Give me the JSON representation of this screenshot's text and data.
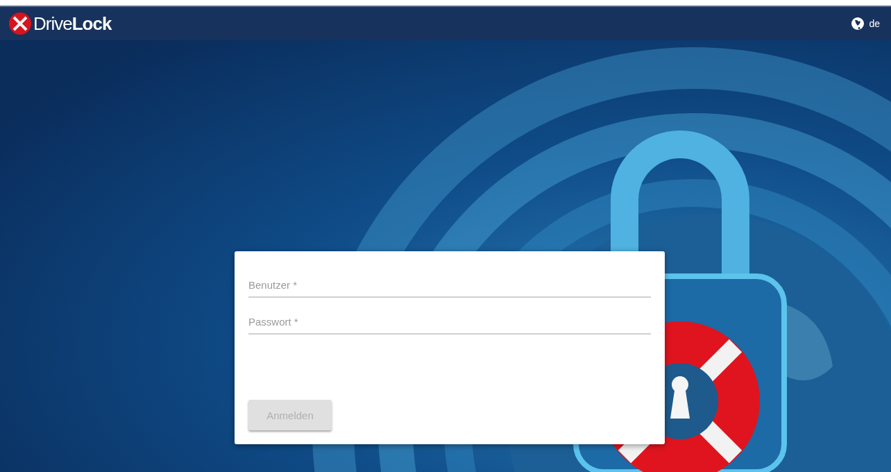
{
  "header": {
    "logo": "Drive**Lock**",
    "language": "de"
  },
  "login_form": {
    "fields": [
      {
        "placeholder": "Benutzer *"
      },
      {
        "placeholder": "Passwort *"
      }
    ],
    "submit": {
      "label": "Anmelden",
      "disabled": true
    }
  }
}
